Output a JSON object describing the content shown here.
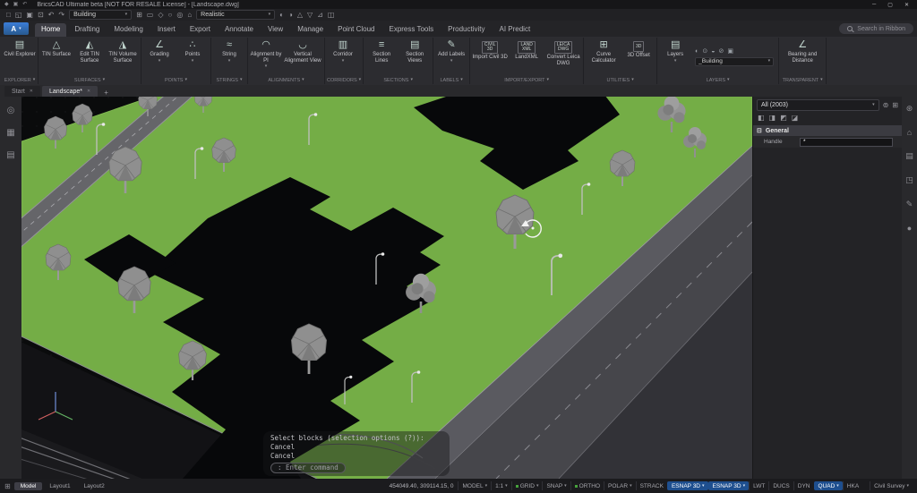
{
  "glyphs": {
    "caret": "▾",
    "close": "✕",
    "plus": "+",
    "minimize": "─",
    "maximize": "▢",
    "collapse": "⊟",
    "grid_tab": "⊞"
  },
  "window": {
    "title": "BricsCAD Ultimate beta [NOT FOR RESALE License] - [Landscape.dwg]"
  },
  "titlebar_icons": [
    {
      "glyph": "◆"
    },
    {
      "glyph": "▣"
    },
    {
      "glyph": "↶"
    }
  ],
  "app_button": {
    "label": "A"
  },
  "quick_toolbar": {
    "workspace_label": "Building",
    "visual_style": "Realistic",
    "left_icons": [
      {
        "glyph": "□"
      },
      {
        "glyph": "◱"
      },
      {
        "glyph": "▣"
      },
      {
        "glyph": "⊡"
      },
      {
        "glyph": "↶"
      },
      {
        "glyph": "↷"
      }
    ],
    "mid_icons": [
      {
        "glyph": "⊞"
      },
      {
        "glyph": "▭"
      },
      {
        "glyph": "◇"
      },
      {
        "glyph": "○"
      },
      {
        "glyph": "◎"
      },
      {
        "glyph": "⌂"
      }
    ],
    "right_icons": [
      {
        "glyph": "◐"
      },
      {
        "glyph": "◑"
      },
      {
        "glyph": "△"
      },
      {
        "glyph": "▽"
      },
      {
        "glyph": "⊿"
      },
      {
        "glyph": "◫"
      }
    ]
  },
  "ribbon": {
    "search_label": "Search in Ribbon",
    "tabs": [
      {
        "label": "Home"
      },
      {
        "label": "Drafting"
      },
      {
        "label": "Modeling"
      },
      {
        "label": "Insert"
      },
      {
        "label": "Export"
      },
      {
        "label": "Annotate"
      },
      {
        "label": "View"
      },
      {
        "label": "Manage"
      },
      {
        "label": "Point Cloud"
      },
      {
        "label": "Express Tools"
      },
      {
        "label": "Productivity"
      },
      {
        "label": "AI Predict"
      }
    ],
    "groups": [
      {
        "label": "EXPLORER",
        "buttons": [
          {
            "label": "Civil Explorer",
            "icon": "▤"
          }
        ]
      },
      {
        "label": "SURFACES",
        "buttons": [
          {
            "label": "TIN Surface",
            "icon": "△"
          },
          {
            "label": "Edit TIN Surface",
            "icon": "◭"
          },
          {
            "label": "TIN Volume Surface",
            "icon": "◮"
          }
        ]
      },
      {
        "label": "POINTS",
        "buttons": [
          {
            "label": "Grading",
            "icon": "∠"
          },
          {
            "label": "Points",
            "icon": "∴"
          }
        ]
      },
      {
        "label": "STRINGS",
        "buttons": [
          {
            "label": "String",
            "icon": "≈"
          }
        ]
      },
      {
        "label": "ALIGNMENTS",
        "buttons": [
          {
            "label": "Alignment by PI",
            "icon": "◠"
          },
          {
            "label": "Vertical Alignment View",
            "icon": "◡"
          }
        ]
      },
      {
        "label": "CORRIDORS",
        "buttons": [
          {
            "label": "Corridor",
            "icon": "▥"
          }
        ]
      },
      {
        "label": "SECTIONS",
        "buttons": [
          {
            "label": "Section Lines",
            "icon": "≡"
          },
          {
            "label": "Section Views",
            "icon": "▤"
          }
        ]
      },
      {
        "label": "LABELS",
        "buttons": [
          {
            "label": "Add Labels",
            "icon": "✎"
          }
        ]
      },
      {
        "label": "IMPORT/EXPORT",
        "buttons": [
          {
            "label": "Import Civil 3D",
            "badge": "CIVIL\n3D"
          },
          {
            "label": "LandXML",
            "badge": "LAND\nXML"
          },
          {
            "label": "Convert Leica DWG",
            "badge": "LEICA\nDWG"
          }
        ]
      },
      {
        "label": "UTILITIES",
        "buttons": [
          {
            "label": "Curve Calculator",
            "icon": "⊞"
          },
          {
            "label": "3D Offset",
            "badge": "3D"
          }
        ]
      },
      {
        "label": "LAYERS",
        "buttons": [
          {
            "label": "Layers",
            "icon": "▤"
          }
        ],
        "layer_combo": "_Building",
        "small_icons": [
          {
            "glyph": "◐"
          },
          {
            "glyph": "⊙"
          },
          {
            "glyph": "◒"
          },
          {
            "glyph": "⊘"
          },
          {
            "glyph": "▣"
          }
        ]
      },
      {
        "label": "TRANSPARENT",
        "buttons": [
          {
            "label": "Bearing and Distance",
            "icon": "∠"
          }
        ]
      }
    ]
  },
  "doc_tabs": [
    {
      "label": "Start"
    },
    {
      "label": "Landscape*"
    }
  ],
  "left_rail": [
    {
      "glyph": "◎"
    },
    {
      "glyph": "▦"
    },
    {
      "glyph": "▤"
    }
  ],
  "right_rail": [
    {
      "glyph": "⊛"
    },
    {
      "glyph": "⌂"
    },
    {
      "glyph": "▤"
    },
    {
      "glyph": "◳"
    },
    {
      "glyph": "✎"
    },
    {
      "glyph": "●"
    }
  ],
  "properties_panel": {
    "selection": "All (2003)",
    "head_icons": [
      {
        "glyph": "⊚"
      },
      {
        "glyph": "⊞"
      }
    ],
    "filter_icons": [
      {
        "glyph": "◧"
      },
      {
        "glyph": "◨"
      },
      {
        "glyph": "◩"
      },
      {
        "glyph": "◪"
      }
    ],
    "section": "General",
    "rows": [
      {
        "label": "Handle",
        "value": "*"
      }
    ]
  },
  "command_line": {
    "lines": [
      "Select blocks (selection options (?)):",
      "Cancel",
      "Cancel"
    ],
    "prompt": ": Enter command"
  },
  "status_bar": {
    "model_tab": "Model",
    "layout_tabs": [
      "Layout1",
      "Layout2"
    ],
    "coordinates": "454049.40, 309114.15, 0",
    "toggles": [
      {
        "label": "MODEL"
      },
      {
        "label": "1:1"
      },
      {
        "label": "GRID"
      },
      {
        "label": "SNAP"
      },
      {
        "label": "ORTHO"
      },
      {
        "label": "POLAR"
      },
      {
        "label": "STRACK"
      },
      {
        "label": "ESNAP 3D"
      },
      {
        "label": "ESNAP 3D"
      },
      {
        "label": "LWT"
      },
      {
        "label": "DUCS"
      },
      {
        "label": "DYN"
      },
      {
        "label": "QUAD"
      },
      {
        "label": "HKA"
      },
      {
        "label": "Civil Survey"
      }
    ]
  },
  "accent_colors": {
    "terrain_green": "#74ad46",
    "selection_blue": "#1f4e8c",
    "road_gray": "#46464b"
  }
}
